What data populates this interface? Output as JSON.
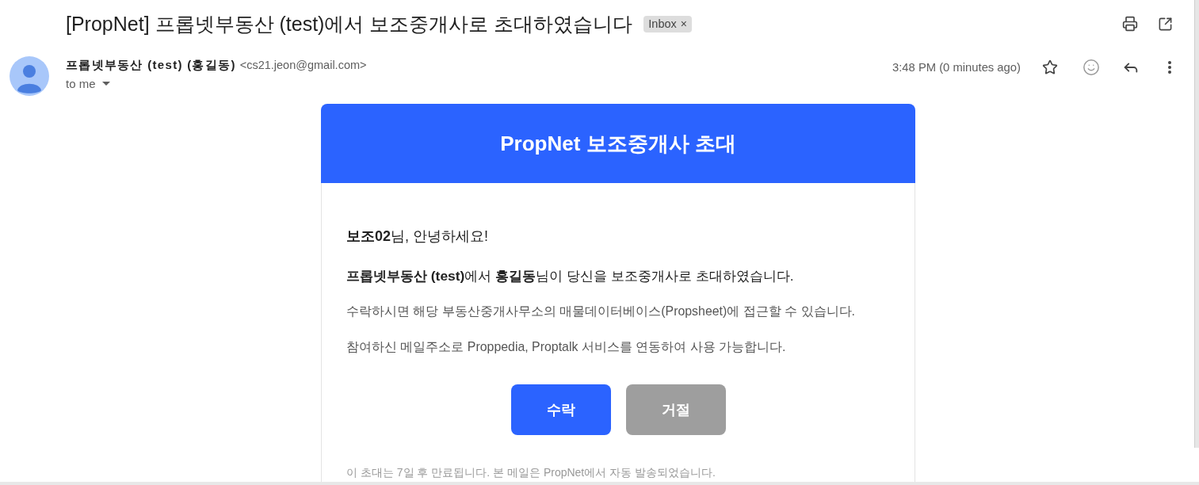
{
  "email": {
    "subject": "[PropNet] 프롭넷부동산 (test)에서 보조중개사로 초대하였습니다",
    "labels": [
      {
        "text": "Inbox",
        "remove": "×"
      }
    ]
  },
  "sender": {
    "name": "프롭넷부동산 (test) (홍길동)",
    "address": "<cs21.jeon@gmail.com>",
    "recipient": "to me",
    "time": "3:48 PM (0 minutes ago)",
    "starred": false
  },
  "card": {
    "title": "PropNet 보조중개사 초대",
    "greeting": "**보조02**님, 안녕하세요!",
    "paragraphs": [
      {
        "kind": "main",
        "text": "**프롭넷부동산 (test)**에서 **홍길동**님이 당신을 보조중개사로 초대하였습니다."
      },
      {
        "kind": "detail",
        "text": "수락하시면 해당 부동산중개사무소의 매물데이터베이스(Propsheet)에 접근할 수 있습니다."
      },
      {
        "kind": "detail",
        "text": "참여하신 메일주소로 Proppedia, Proptalk 서비스를 연동하여 사용 가능합니다."
      }
    ],
    "buttons": [
      {
        "kind": "accept",
        "label": "수락"
      },
      {
        "kind": "decline",
        "label": "거절"
      }
    ],
    "footer": "이 초대는 7일 후 만료됩니다. 본 메일은 PropNet에서 자동 발송되었습니다."
  }
}
